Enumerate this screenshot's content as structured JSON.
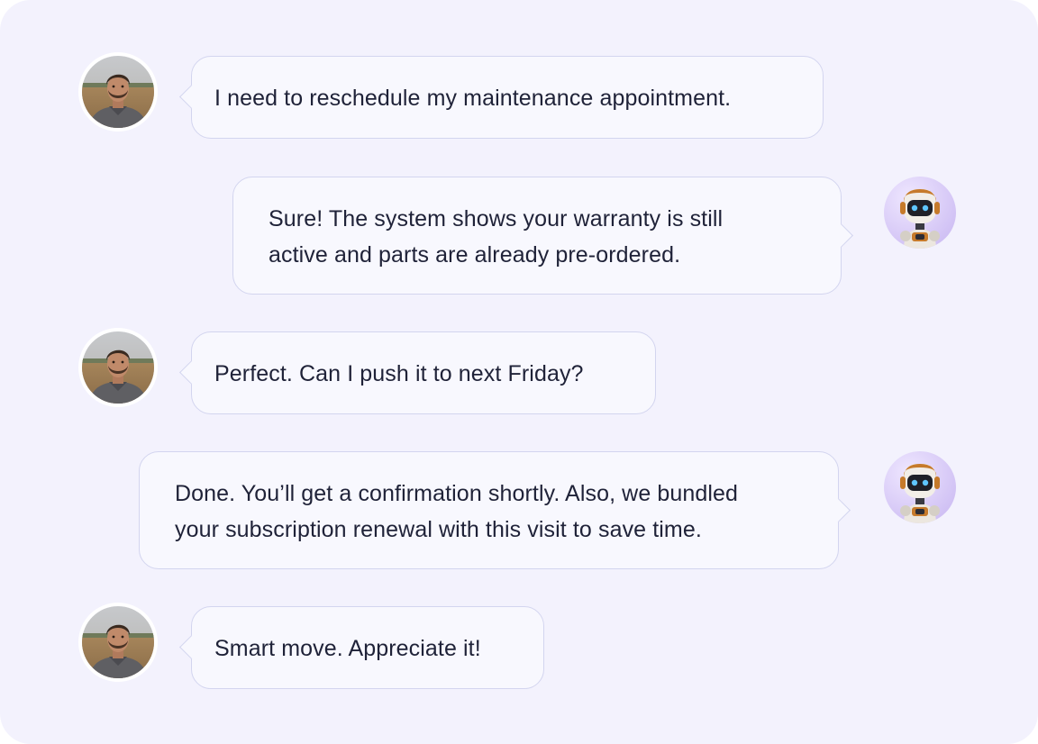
{
  "conversation": {
    "messages": [
      {
        "sender": "user",
        "avatar_icon": "user-avatar-photo",
        "lines": [
          "I need to reschedule my maintenance appointment."
        ]
      },
      {
        "sender": "assistant",
        "avatar_icon": "robot-avatar",
        "lines": [
          "Sure! The system shows your warranty is still",
          "active and parts are already pre-ordered."
        ]
      },
      {
        "sender": "user",
        "avatar_icon": "user-avatar-photo",
        "lines": [
          "Perfect. Can I push it to next Friday?"
        ]
      },
      {
        "sender": "assistant",
        "avatar_icon": "robot-avatar",
        "lines": [
          "Done. You’ll get a confirmation shortly. Also, we bundled",
          "your subscription renewal with this visit to save time."
        ]
      },
      {
        "sender": "user",
        "avatar_icon": "user-avatar-photo",
        "lines": [
          "Smart move. Appreciate it!"
        ]
      }
    ]
  },
  "colors": {
    "panel_background": "#f3f2fd",
    "bubble_background": "#f8f8fe",
    "bubble_border": "#d3d5ef",
    "text": "#1f2238",
    "robot_avatar_background": "#e2d8fb"
  }
}
